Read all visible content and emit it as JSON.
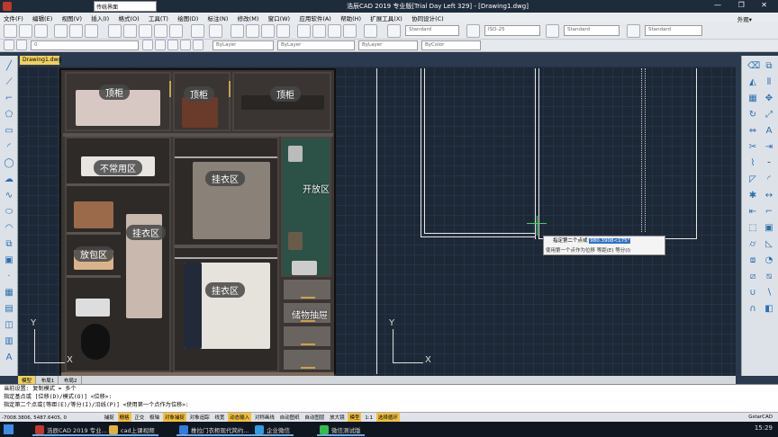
{
  "window": {
    "workspace": "传统界面",
    "title": "浩辰CAD 2019 专业版[Trial Day Left 329] - [Drawing1.dwg]",
    "controls": "— ❐ ✕"
  },
  "menu": {
    "items": [
      "文件(F)",
      "编辑(E)",
      "视图(V)",
      "插入(I)",
      "格式(O)",
      "工具(T)",
      "绘图(D)",
      "标注(N)",
      "修改(M)",
      "窗口(W)",
      "应用软件(A)",
      "帮助(H)",
      "扩展工具(X)",
      "协同设计(C)"
    ],
    "extra": "外观▾"
  },
  "toolbar": {
    "text_style": "Standard",
    "dim_style": "ISO-25",
    "table_style": "Standard",
    "multileader_style": "Standard",
    "layer": "0",
    "color": "ByLayer",
    "linetype": "ByLayer",
    "lineweight": "ByLayer",
    "plotstyle": "ByColor"
  },
  "document_tab": "Drawing1.dwg",
  "image_labels": {
    "top1": "顶柜",
    "top2": "顶柜",
    "top3": "顶柜",
    "rare": "不常用区",
    "bag": "放包区",
    "hang1": "挂衣区",
    "hang2": "挂衣区",
    "hang3": "挂衣区",
    "open": "开放区",
    "storage": "储物抽屉"
  },
  "ucs": {
    "x": "X",
    "y": "Y"
  },
  "prompt_popup": {
    "label": "指定第二个点或",
    "value": "980.3908<175°",
    "options": "使用第一个点作为位移  等距(E)  等分(I)"
  },
  "layout_tabs": [
    "模型",
    "布局1",
    "布局2"
  ],
  "command_lines": [
    "当前设置: 复制模式 = 多个",
    "指定基点或 [位移(D)/模式(O)] <位移>:",
    "指定第二个点或[等距(E)/等分(I)/沿线(P)] <使用第一个点作为位移>:"
  ],
  "status": {
    "coords": "-7008.3806, 5487.6405, 0",
    "toggles": [
      "捕捉",
      "栅格",
      "正交",
      "极轴",
      "对象捕捉",
      "对象追踪",
      "线宽",
      "动态输入",
      "对称画线",
      "自动图纸",
      "自动图层",
      "放大镜",
      "模型",
      "1:1",
      "选择循环"
    ],
    "active": [
      "栅格",
      "对象捕捉",
      "动态输入",
      "模型",
      "选择循环"
    ],
    "brand": "GstarCAD"
  },
  "taskbar": {
    "items": [
      {
        "label": "浩辰CAD 2019 专业...",
        "color": "#c0392b"
      },
      {
        "label": "cad上课视频",
        "color": "#e0b040"
      },
      {
        "label": "推拉门衣柜现代简约...",
        "color": "#2f7de1"
      },
      {
        "label": "企业微信",
        "color": "#2f9de1"
      },
      {
        "label": "微信测试版",
        "color": "#2fbf4f"
      }
    ],
    "time": "15:29"
  }
}
